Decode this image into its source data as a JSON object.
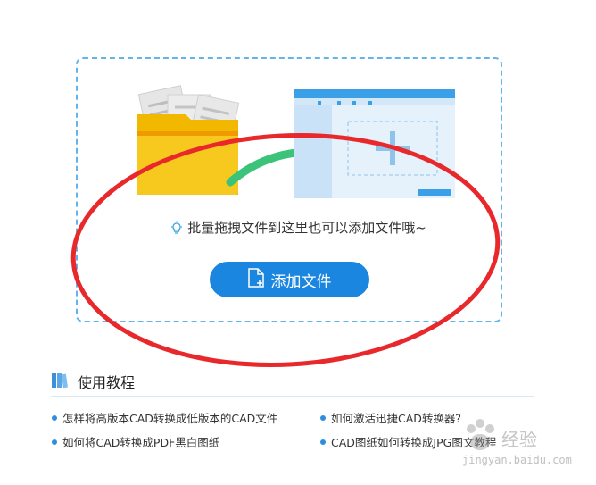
{
  "dropzone": {
    "hint": "批量拖拽文件到这里也可以添加文件哦~",
    "add_button_label": "添加文件"
  },
  "tutorials": {
    "title": "使用教程",
    "links": [
      "怎样将高版本CAD转换成低版本的CAD文件",
      "如何激活迅捷CAD转换器？",
      "如何将CAD转换成PDF黑白图纸",
      "CAD图纸如何转换成JPG图文教程"
    ]
  },
  "watermark": {
    "brand": "经验",
    "url": "jingyan.baidu.com"
  },
  "colors": {
    "accent": "#1a86e0",
    "dashed_border": "#62b4ea",
    "annotation": "#e8282b"
  }
}
